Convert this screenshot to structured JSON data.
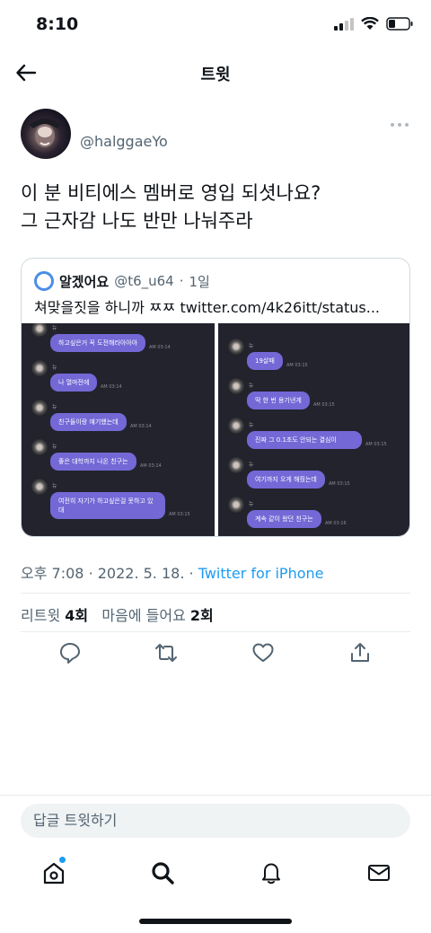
{
  "status_bar": {
    "time": "8:10"
  },
  "nav": {
    "title": "트윗"
  },
  "tweet": {
    "handle": "@halggaeYo",
    "text": "이 분 비티에스 멤버로 영입 되셧나요?\n그 근자감 나도 반만 나눠주라",
    "time": "오후 7:08",
    "date": "2022. 5. 18.",
    "source": "Twitter for iPhone",
    "stats": {
      "retweet_label": "리트윗",
      "retweet_count": "4회",
      "like_label": "마음에 들어요",
      "like_count": "2회"
    }
  },
  "quote": {
    "name": "알겠어요",
    "handle": "@t6_u64",
    "age": "1일",
    "text": "쳐맞을짓을 하니까 ㅉㅉ twitter.com/4k26itt/status...",
    "left_messages": [
      {
        "text": "하고싶은거 꼭 도전해라아아아",
        "time": "AM 03:14"
      },
      {
        "text": "나 열마전에",
        "time": "AM 03:14"
      },
      {
        "text": "친구들이랑 얘기했는데",
        "time": "AM 03:14"
      },
      {
        "text": "좋은 대학까지 나온 친구는",
        "time": "AM 03:14"
      },
      {
        "text": "여전히 자기가 하고싶은걸 못하고 있대",
        "time": "AM 03:15"
      }
    ],
    "right_messages": [
      {
        "text": "19살때",
        "time": "AM 03:15"
      },
      {
        "text": "딱 한 번 용기낸게",
        "time": "AM 03:15"
      },
      {
        "text": "진짜 그 0.1초도 안되는 결심이",
        "time": "AM 03:15"
      },
      {
        "text": "여기까지 오게 해줬는데",
        "time": "AM 03:15"
      },
      {
        "text": "계속 같이 왔던 친구는",
        "time": "AM 03:16"
      }
    ]
  },
  "reply": {
    "placeholder": "답글 트윗하기"
  },
  "icons": {
    "back": "back-arrow-icon",
    "more": "more-dots-icon",
    "reply": "reply-icon",
    "retweet": "retweet-icon",
    "like": "heart-icon",
    "share": "share-icon",
    "home": "home-icon",
    "search": "search-icon",
    "notifications": "bell-icon",
    "messages": "mail-icon"
  },
  "colors": {
    "accent": "#1d9bf0",
    "bubble": "#7468d6",
    "text": "#0f1419",
    "secondary": "#536471"
  }
}
